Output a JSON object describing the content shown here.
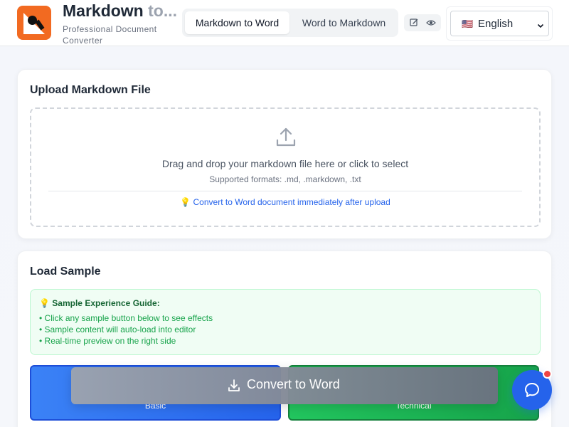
{
  "header": {
    "title_main": "Markdown",
    "title_fade": " to...",
    "subtitle": "Professional Document Converter",
    "mode_tabs": [
      {
        "label": "Markdown to Word",
        "active": true
      },
      {
        "label": "Word to Markdown",
        "active": false
      }
    ],
    "view_toggles": [
      "edit-icon",
      "eye-icon"
    ],
    "language": {
      "flag": "🇺🇸",
      "label": "English"
    }
  },
  "upload": {
    "title": "Upload Markdown File",
    "drop_text": "Drag and drop your markdown file here or click to select",
    "formats": "Supported formats: .md, .markdown, .txt",
    "hint_icon": "💡",
    "hint_text": "Convert to Word document immediately after upload"
  },
  "samples": {
    "title": "Load Sample",
    "guide_icon": "💡",
    "guide_title": "Sample Experience Guide:",
    "guide_items": [
      "• Click any sample button below to see effects",
      "• Sample content will auto-load into editor",
      "• Real-time preview on the right side"
    ],
    "buttons": [
      {
        "label": "Basic",
        "color": "#2563eb"
      },
      {
        "label": "Technical",
        "color": "#16a34a"
      }
    ]
  },
  "convert_button": {
    "label": "Convert to Word",
    "icon": "download-icon"
  },
  "chat": {
    "icon": "chat-bubble-icon",
    "badge_color": "#ef4444"
  },
  "colors": {
    "accent": "#2563eb",
    "logo": "#f26a21",
    "success": "#16a34a"
  }
}
